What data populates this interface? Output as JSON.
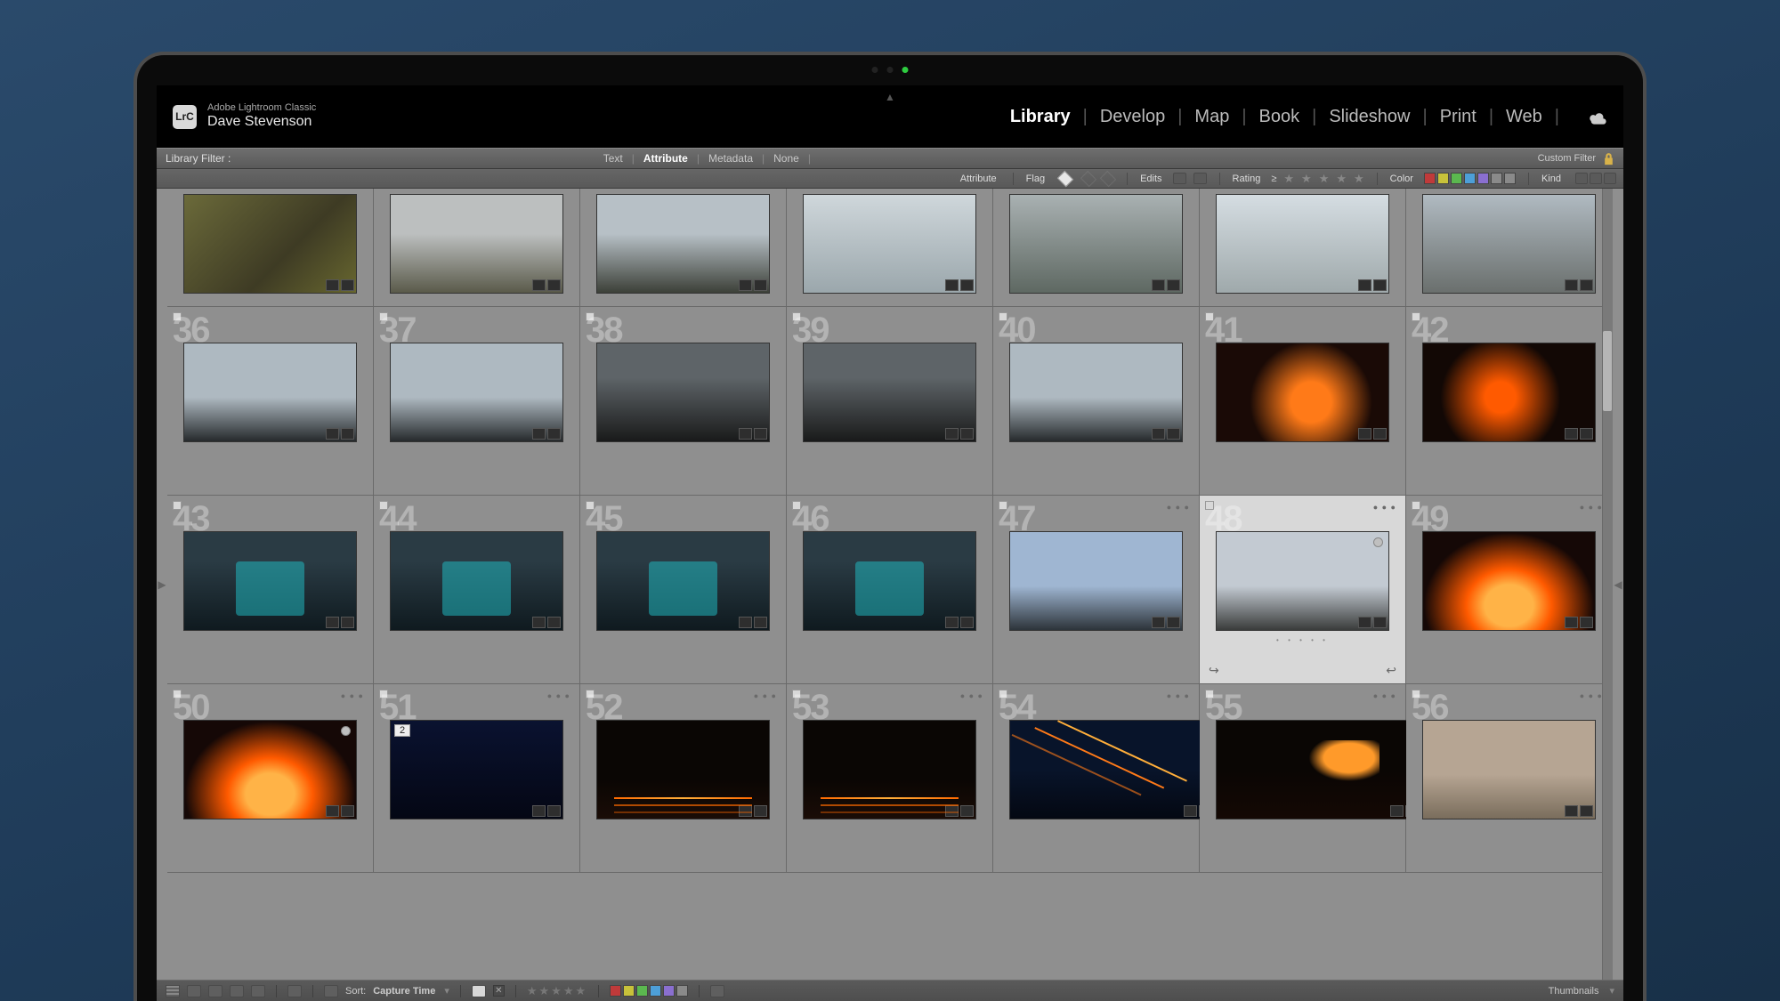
{
  "app": {
    "logo": "LrC",
    "suite": "Adobe Lightroom Classic",
    "user": "Dave Stevenson"
  },
  "modules": {
    "items": [
      "Library",
      "Develop",
      "Map",
      "Book",
      "Slideshow",
      "Print",
      "Web"
    ],
    "active": "Library"
  },
  "filterbar": {
    "label": "Library Filter :",
    "tabs": [
      "Text",
      "Attribute",
      "Metadata",
      "None"
    ],
    "active": "Attribute",
    "custom": "Custom Filter"
  },
  "attrbar": {
    "attribute": "Attribute",
    "flag": "Flag",
    "edits": "Edits",
    "rating": "Rating",
    "rating_op": "≥",
    "color": "Color",
    "kind": "Kind",
    "swatches": [
      "#c03a3a",
      "#c8c23a",
      "#5bb84f",
      "#4d9fd8",
      "#8a6fd0",
      "#8a8a8a",
      "#8a8a8a"
    ]
  },
  "grid": {
    "rows": [
      {
        "cells": [
          {
            "thumb": "th-rock"
          },
          {
            "thumb": "th-falls"
          },
          {
            "thumb": "th-hiker"
          },
          {
            "thumb": "th-mist"
          },
          {
            "thumb": "th-fog"
          },
          {
            "thumb": "th-cloud"
          },
          {
            "thumb": "th-grey"
          }
        ]
      },
      {
        "start": 36,
        "cells": [
          {
            "n": "36",
            "thumb": "th-people"
          },
          {
            "n": "37",
            "thumb": "th-people"
          },
          {
            "n": "38",
            "thumb": "th-dark"
          },
          {
            "n": "39",
            "thumb": "th-dark"
          },
          {
            "n": "40",
            "thumb": "th-people"
          },
          {
            "n": "41",
            "thumb": "th-lava"
          },
          {
            "n": "42",
            "thumb": "th-lava2"
          }
        ]
      },
      {
        "start": 43,
        "cells": [
          {
            "n": "43",
            "thumb": "th-teal",
            "person": true
          },
          {
            "n": "44",
            "thumb": "th-teal",
            "person": true
          },
          {
            "n": "45",
            "thumb": "th-teal",
            "person": true
          },
          {
            "n": "46",
            "thumb": "th-teal",
            "person": true
          },
          {
            "n": "47",
            "thumb": "th-crowd",
            "dots": true
          },
          {
            "n": "48",
            "thumb": "th-plain",
            "dots": true,
            "circle": true,
            "selected": true,
            "belowdots": true,
            "sync": true
          },
          {
            "n": "49",
            "thumb": "th-fire",
            "dots": true
          }
        ]
      },
      {
        "start": 50,
        "cells": [
          {
            "n": "50",
            "thumb": "th-fire",
            "dots": true,
            "circle": true
          },
          {
            "n": "51",
            "thumb": "th-night",
            "dots": true,
            "stack": "2"
          },
          {
            "n": "52",
            "thumb": "th-nightlava",
            "dots": true
          },
          {
            "n": "53",
            "thumb": "th-nightlava",
            "dots": true
          },
          {
            "n": "54",
            "thumb": "th-stream",
            "dots": true
          },
          {
            "n": "55",
            "thumb": "th-pour",
            "dots": true
          },
          {
            "n": "56",
            "thumb": "th-family",
            "dots": true
          }
        ]
      }
    ]
  },
  "bottombar": {
    "sort_label": "Sort:",
    "sort_value": "Capture Time",
    "swatches": [
      "#c03a3a",
      "#c8c23a",
      "#5bb84f",
      "#4d9fd8",
      "#8a6fd0",
      "#8a8a8a"
    ],
    "right": "Thumbnails"
  }
}
